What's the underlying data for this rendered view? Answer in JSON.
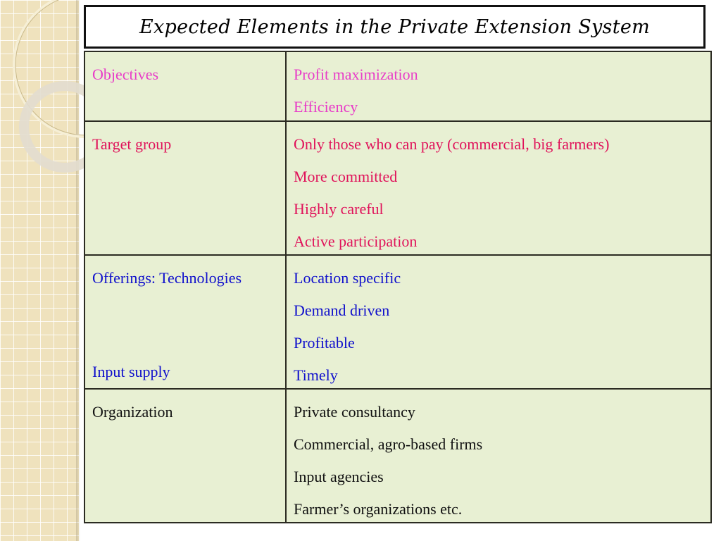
{
  "slide": {
    "title": "Expected Elements in the Private Extension System",
    "colors": {
      "objectives": "#e83cc8",
      "target": "#e0125a",
      "offerings": "#1010cc",
      "organization": "#111111",
      "table_bg": "#e8f0d3",
      "side_strip": "#efe2bd"
    }
  },
  "table": {
    "rows": [
      {
        "label": "Objectives",
        "label_secondary": null,
        "items": [
          "Profit maximization",
          "Efficiency"
        ]
      },
      {
        "label": "Target group",
        "label_secondary": null,
        "items": [
          "Only those who can pay (commercial, big farmers)",
          "More committed",
          "Highly careful",
          "Active participation"
        ]
      },
      {
        "label": "Offerings: Technologies",
        "label_secondary": "Input supply",
        "items": [
          "Location specific",
          "Demand driven",
          "Profitable",
          "Timely"
        ]
      },
      {
        "label": "Organization",
        "label_secondary": null,
        "items": [
          "Private consultancy",
          "Commercial, agro-based firms",
          "Input agencies",
          "Farmer’s organizations etc."
        ]
      }
    ]
  }
}
